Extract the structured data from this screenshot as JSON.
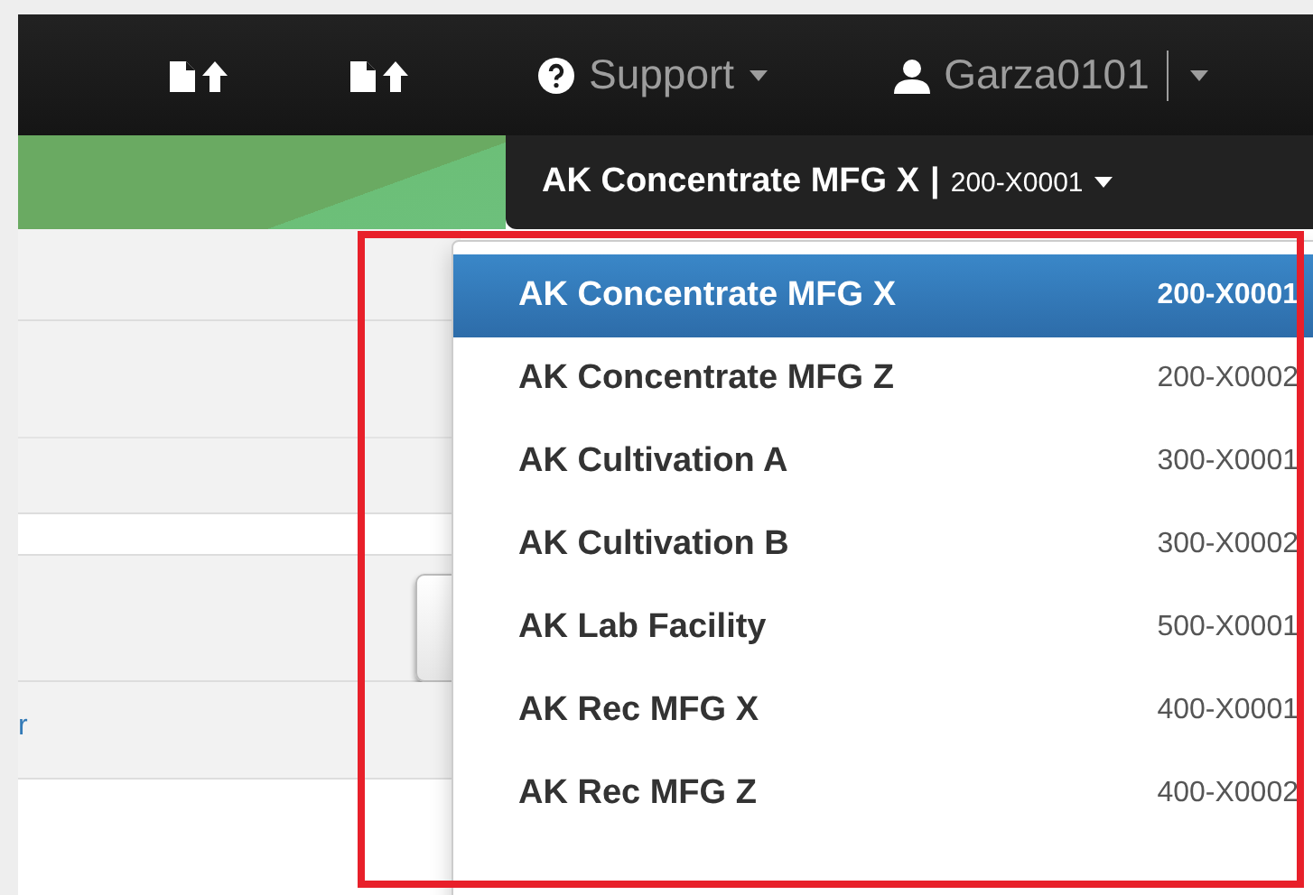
{
  "navbar": {
    "support_label": "Support",
    "user_label": "Garza0101"
  },
  "facility_button": {
    "name": "AK Concentrate MFG X",
    "separator": "|",
    "code": "200-X0001"
  },
  "facility_menu": {
    "items": [
      {
        "name": "AK Concentrate MFG X",
        "code": "200-X0001",
        "selected": true
      },
      {
        "name": "AK Concentrate MFG Z",
        "code": "200-X0002",
        "selected": false
      },
      {
        "name": "AK Cultivation A",
        "code": "300-X0001",
        "selected": false
      },
      {
        "name": "AK Cultivation B",
        "code": "300-X0002",
        "selected": false
      },
      {
        "name": "AK Lab Facility",
        "code": "500-X0001",
        "selected": false
      },
      {
        "name": "AK Rec MFG X",
        "code": "400-X0001",
        "selected": false
      },
      {
        "name": "AK Rec MFG Z",
        "code": "400-X0002",
        "selected": false
      }
    ]
  },
  "content": {
    "link": "r"
  },
  "annotation": {
    "kind": "rectangle"
  }
}
